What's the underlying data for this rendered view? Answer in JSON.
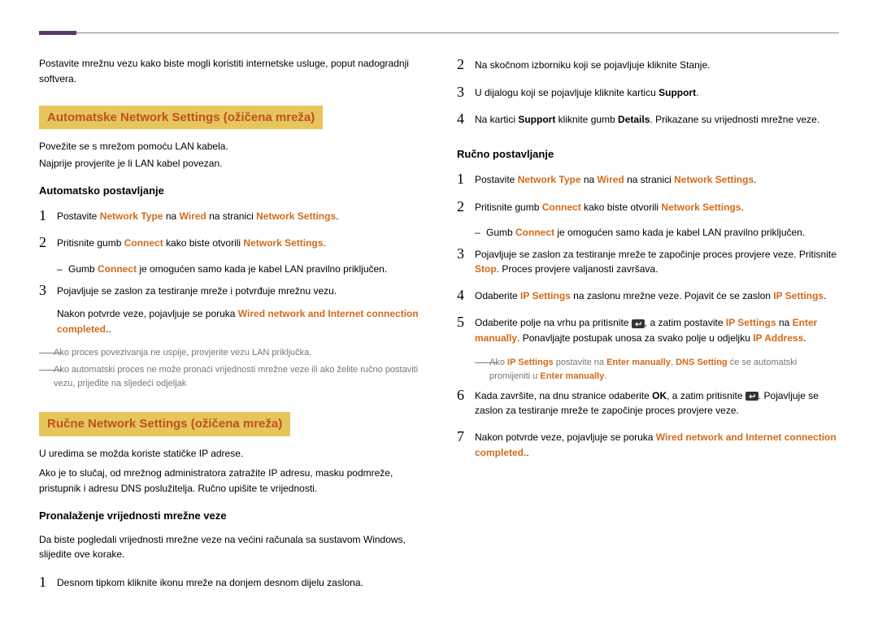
{
  "left": {
    "intro": "Postavite mrežnu vezu kako biste mogli koristiti internetske usluge, poput nadogradnji softvera.",
    "auto_title": "Automatske Network Settings  (ožičena mreža)",
    "auto_p1": "Povežite se s mrežom pomoću LAN kabela.",
    "auto_p2": "Najprije provjerite je li LAN kabel povezan.",
    "auto_sub": "Automatsko postavljanje",
    "s1a": "Postavite ",
    "s1b": "Network Type",
    "s1c": " na ",
    "s1d": "Wired",
    "s1e": " na stranici ",
    "s1f": "Network Settings",
    "s1g": ".",
    "s2a": "Pritisnite gumb ",
    "s2b": "Connect",
    "s2c": " kako biste otvorili ",
    "s2d": "Network Settings",
    "s2e": ".",
    "s2_sub_a": "Gumb ",
    "s2_sub_b": "Connect",
    "s2_sub_c": " je omogućen samo kada je kabel LAN pravilno priključen.",
    "s3": "Pojavljuje se zaslon za testiranje mreže i potvrđuje mrežnu vezu.",
    "s3_after_a": "Nakon potvrde veze, pojavljuje se poruka ",
    "s3_after_b": "Wired network and Internet connection completed.",
    "s3_after_c": ".",
    "note1": "Ako proces povezivanja ne uspije, provjerite vezu LAN priključka.",
    "note2": "Ako automatski proces ne može pronaći vrijednosti mrežne veze ili ako želite ručno postaviti vezu, prijeđite na sljedeći odjeljak",
    "man_title": "Ručne Network Settings  (ožičena mreža)",
    "man_p1": "U uredima se možda koriste statičke IP adrese.",
    "man_p2": "Ako je to slučaj, od mrežnog administratora zatražite IP adresu, masku podmreže, pristupnik i adresu DNS poslužitelja. Ručno upišite te vrijednosti.",
    "find_sub": "Pronalaženje vrijednosti mrežne veze",
    "find_p": "Da biste pogledali vrijednosti mrežne veze na većini računala sa sustavom Windows, slijedite ove korake.",
    "f1": "Desnom tipkom kliknite ikonu mreže na donjem desnom dijelu zaslona."
  },
  "right": {
    "f2": "Na skočnom izborniku koji se pojavljuje kliknite Stanje.",
    "f3a": "U dijalogu koji se pojavljuje kliknite karticu ",
    "f3b": "Support",
    "f3c": ".",
    "f4a": "Na kartici ",
    "f4b": "Support",
    "f4c": " kliknite gumb ",
    "f4d": "Details",
    "f4e": ". Prikazane su vrijednosti mrežne veze.",
    "man_sub": "Ručno postavljanje",
    "m1a": "Postavite ",
    "m1b": "Network Type",
    "m1c": " na ",
    "m1d": "Wired",
    "m1e": " na stranici ",
    "m1f": "Network Settings",
    "m1g": ".",
    "m2a": "Pritisnite gumb ",
    "m2b": "Connect",
    "m2c": " kako biste otvorili ",
    "m2d": "Network Settings",
    "m2e": ".",
    "m2_sub_a": "Gumb ",
    "m2_sub_b": "Connect",
    "m2_sub_c": " je omogućen samo kada je kabel LAN pravilno priključen.",
    "m3a": "Pojavljuje se zaslon za testiranje mreže te započinje proces provjere veze. Pritisnite ",
    "m3b": "Stop",
    "m3c": ". Proces provjere valjanosti završava.",
    "m4a": "Odaberite ",
    "m4b": "IP Settings",
    "m4c": " na zaslonu mrežne veze. Pojavit će se zaslon ",
    "m4d": "IP Settings",
    "m4e": ".",
    "m5a": "Odaberite polje na vrhu pa pritisnite ",
    "m5b": ", a zatim postavite ",
    "m5c": "IP Settings",
    "m5d": " na ",
    "m5e": "Enter manually",
    "m5f": ". Ponavljajte postupak unosa za svako polje u odjeljku ",
    "m5g": "IP Address",
    "m5h": ".",
    "m5_note_a": "Ako ",
    "m5_note_b": "IP Settings",
    "m5_note_c": " postavite na ",
    "m5_note_d": "Enter manually",
    "m5_note_e": ", ",
    "m5_note_f": "DNS Setting",
    "m5_note_g": " će se automatski promijeniti u ",
    "m5_note_h": "Enter manually",
    "m5_note_i": ".",
    "m6a": "Kada završite, na dnu stranice odaberite ",
    "m6b": "OK",
    "m6c": ", a zatim pritisnite ",
    "m6d": ". Pojavljuje se zaslon za testiranje mreže te započinje proces provjere veze.",
    "m7a": "Nakon potvrde veze, pojavljuje se poruka ",
    "m7b": "Wired network and Internet connection completed.",
    "m7c": "."
  },
  "nums": {
    "n1": "1",
    "n2": "2",
    "n3": "3",
    "n4": "4",
    "n5": "5",
    "n6": "6",
    "n7": "7"
  },
  "glyph": {
    "dash": "‒",
    "long": "――"
  }
}
